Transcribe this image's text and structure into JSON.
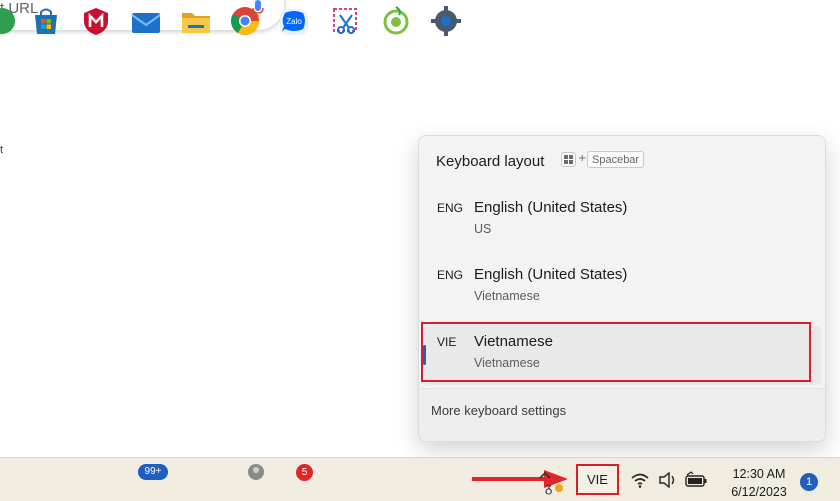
{
  "browser": {
    "search_placeholder": "t URL",
    "edge_text": "t"
  },
  "flyout": {
    "title": "Keyboard layout",
    "shortcut": {
      "key1_icon": "windows-key-icon",
      "plus": "+",
      "key2": "Spacebar"
    },
    "layouts": [
      {
        "code": "ENG",
        "name": "English (United States)",
        "sub": "US",
        "selected": false
      },
      {
        "code": "ENG",
        "name": "English (United States)",
        "sub": "Vietnamese",
        "selected": false
      },
      {
        "code": "VIE",
        "name": "Vietnamese",
        "sub": "Vietnamese",
        "selected": true
      }
    ],
    "footer_link": "More keyboard settings"
  },
  "taskbar": {
    "icons": [
      "partial-green-icon",
      "microsoft-store-icon",
      "mcafee-icon",
      "mail-icon",
      "file-explorer-icon",
      "chrome-icon",
      "zalo-icon",
      "snipping-tool-icon",
      "coccoc-icon",
      "settings-icon"
    ],
    "mail_badge": "99+",
    "zalo_badge": "5",
    "language_indicator": "VIE",
    "clock_time": "12:30 AM",
    "clock_date": "6/12/2023",
    "notification_count": "1"
  },
  "colors": {
    "highlight": "#d4212a",
    "accent": "#1f5fbf",
    "taskbar_bg": "#f0ecdf",
    "flyout_bg": "#f3f3f3"
  }
}
